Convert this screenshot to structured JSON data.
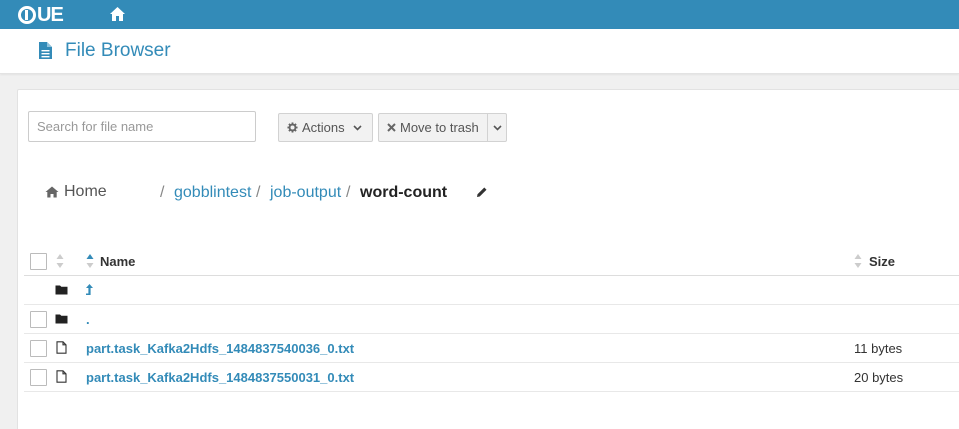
{
  "navbar": {
    "logo_text": "UE",
    "home_icon": "home-icon",
    "bg_color": "#338bb8"
  },
  "header": {
    "icon": "file-icon",
    "title": "File Browser"
  },
  "toolbar": {
    "search_placeholder": "Search for file name",
    "actions_label": "Actions",
    "trash_label": "Move to trash"
  },
  "breadcrumb": {
    "home": "Home",
    "separator": "/",
    "items": [
      "gobblintest",
      "job-output"
    ],
    "current": "word-count"
  },
  "table": {
    "columns": {
      "name": "Name",
      "size": "Size"
    },
    "rows": [
      {
        "type": "parent-dir",
        "name": "",
        "size": ""
      },
      {
        "type": "dir",
        "name": ".",
        "size": ""
      },
      {
        "type": "file",
        "name": "part.task_Kafka2Hdfs_1484837540036_0.txt",
        "size": "11 bytes"
      },
      {
        "type": "file",
        "name": "part.task_Kafka2Hdfs_1484837550031_0.txt",
        "size": "20 bytes"
      }
    ]
  },
  "colors": {
    "accent": "#338bb8"
  }
}
